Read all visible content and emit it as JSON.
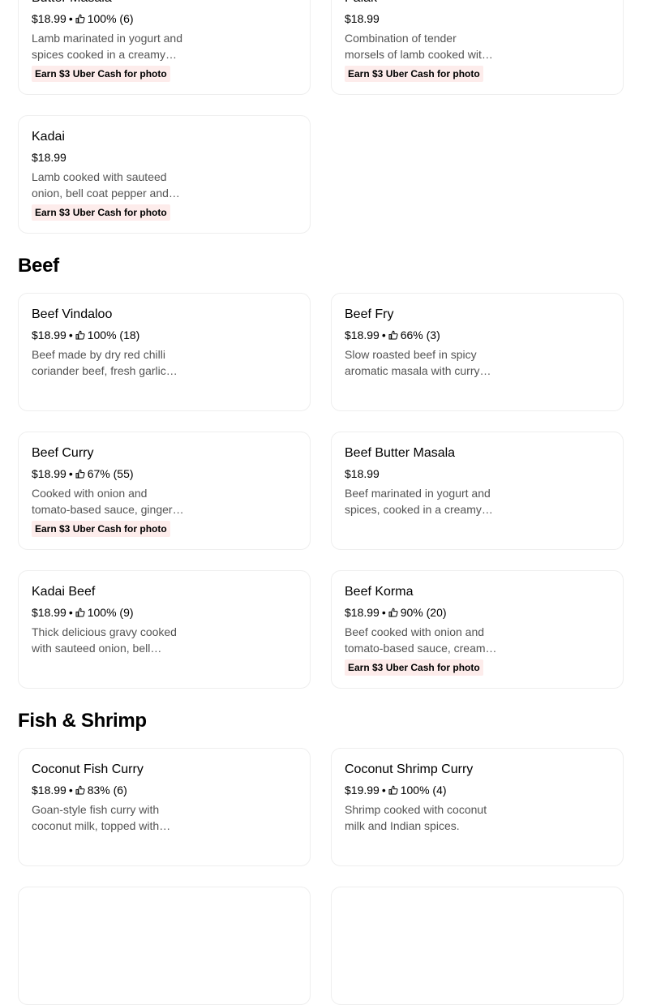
{
  "colors": {
    "promo_bg": "#fdeceb",
    "border": "#eeeeee",
    "desc": "#545454"
  },
  "icons": {
    "rating": "thumbs-up-icon"
  },
  "promo_label": "Earn $3 Uber Cash for photo",
  "top_cards": [
    {
      "name": "Butter Masala",
      "price": "$18.99",
      "rating": "100% (6)",
      "description": "Lamb marinated in yogurt and spices cooked in a creamy butter sauce.",
      "promo": true
    },
    {
      "name": "Palak",
      "price": "$18.99",
      "rating": "",
      "description": "Combination of tender morsels of lamb cooked with spinach.",
      "promo": true
    },
    {
      "name": "Kadai",
      "price": "$18.99",
      "rating": "",
      "description": "Lamb cooked with sauteed onion, bell coat pepper and tomatoes.",
      "promo": true
    }
  ],
  "sections": [
    {
      "title": "Beef",
      "items": [
        {
          "name": "Beef Vindaloo",
          "price": "$18.99",
          "rating": "100% (18)",
          "description": "Beef made by dry red chilli coriander beef, fresh garlic and vinegar.",
          "promo": false
        },
        {
          "name": "Beef Fry",
          "price": "$18.99",
          "rating": "66% (3)",
          "description": "Slow roasted beef in spicy aromatic masala with curry leaves.",
          "promo": false
        },
        {
          "name": "Beef Curry",
          "price": "$18.99",
          "rating": "67% (55)",
          "description": "Cooked with onion and tomato-based sauce, ginger and garlic.",
          "promo": true
        },
        {
          "name": "Beef Butter Masala",
          "price": "$18.99",
          "rating": "",
          "description": "Beef marinated in yogurt and spices, cooked in a creamy sauce.",
          "promo": false
        },
        {
          "name": "Kadai Beef",
          "price": "$18.99",
          "rating": "100% (9)",
          "description": "Thick delicious gravy cooked with sauteed onion, bell pepper.",
          "promo": false
        },
        {
          "name": "Beef Korma",
          "price": "$18.99",
          "rating": "90% (20)",
          "description": "Beef cooked with onion and tomato-based sauce, cream and nuts.",
          "promo": true
        }
      ]
    },
    {
      "title": "Fish & Shrimp",
      "items": [
        {
          "name": "Coconut Fish Curry",
          "price": "$18.99",
          "rating": "83% (6)",
          "description": "Goan-style fish curry with coconut milk, topped with coriander.",
          "promo": false
        },
        {
          "name": "Coconut Shrimp Curry",
          "price": "$19.99",
          "rating": "100% (4)",
          "description": "Shrimp cooked with coconut milk and Indian spices.",
          "promo": false
        },
        {
          "name": "",
          "price": "",
          "rating": "",
          "description": "",
          "promo": false
        },
        {
          "name": "",
          "price": "",
          "rating": "",
          "description": "",
          "promo": false
        }
      ]
    }
  ]
}
